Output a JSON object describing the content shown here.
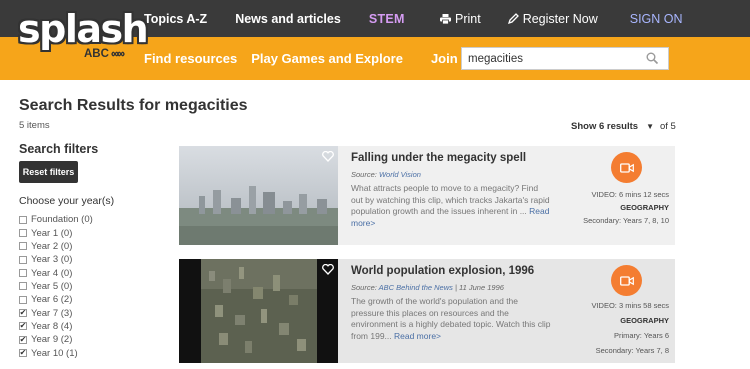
{
  "logo": {
    "word": "splash",
    "abc": "ABC"
  },
  "topnav": {
    "topics": "Topics A-Z",
    "news": "News and articles",
    "stem": "STEM",
    "print": "Print",
    "register": "Register Now",
    "signon": "SIGN ON"
  },
  "mainnav": {
    "find": "Find resources",
    "play": "Play Games and Explore",
    "join": "Join in"
  },
  "search": {
    "value": "megacities"
  },
  "results": {
    "title": "Search Results for megacities",
    "count": "5 items",
    "show_label": "Show 6 results",
    "of_pages": "of 5"
  },
  "sidebar": {
    "filters_title": "Search filters",
    "reset_label": "Reset filters",
    "year_title": "Choose your year(s)",
    "years": [
      {
        "label": "Foundation (0)",
        "checked": false
      },
      {
        "label": "Year 1 (0)",
        "checked": false
      },
      {
        "label": "Year 2 (0)",
        "checked": false
      },
      {
        "label": "Year 3 (0)",
        "checked": false
      },
      {
        "label": "Year 4 (0)",
        "checked": false
      },
      {
        "label": "Year 5 (0)",
        "checked": false
      },
      {
        "label": "Year 6 (2)",
        "checked": false
      },
      {
        "label": "Year 7 (3)",
        "checked": true
      },
      {
        "label": "Year 8 (4)",
        "checked": true
      },
      {
        "label": "Year 9 (2)",
        "checked": true
      },
      {
        "label": "Year 10 (1)",
        "checked": true
      }
    ]
  },
  "cards": [
    {
      "title": "Falling under the megacity spell",
      "source_prefix": "Source:",
      "source": "World Vision",
      "date": "",
      "desc": "What attracts people to move to a megacity? Find out by watching this clip, which tracks Jakarta's rapid population growth and the issues inherent in ... ",
      "more": "Read more>",
      "duration": "VIDEO: 6 mins 12 secs",
      "subject": "GEOGRAPHY",
      "levels": [
        "Secondary: Years 7, 8, 10"
      ]
    },
    {
      "title": "World population explosion, 1996",
      "source_prefix": "Source:",
      "source": "ABC Behind the News",
      "date": "| 11 June 1996",
      "desc": "The growth of the world's population and the pressure this places on resources and the environment is a highly debated topic. Watch this clip from 199... ",
      "more": "Read more>",
      "duration": "VIDEO: 3 mins 58 secs",
      "subject": "GEOGRAPHY",
      "levels": [
        "Primary: Years 6",
        "Secondary: Years 7, 8"
      ]
    }
  ],
  "colors": {
    "topbar": "#3a3a3a",
    "orange": "#f6a51a",
    "accent": "#f47d31",
    "stem": "#d59cf2",
    "link": "#4a6fa5"
  },
  "icons": {
    "print": "printer-icon",
    "register": "pencil-icon",
    "search": "search-icon",
    "favorite": "heart-icon",
    "video": "video-camera-icon"
  }
}
